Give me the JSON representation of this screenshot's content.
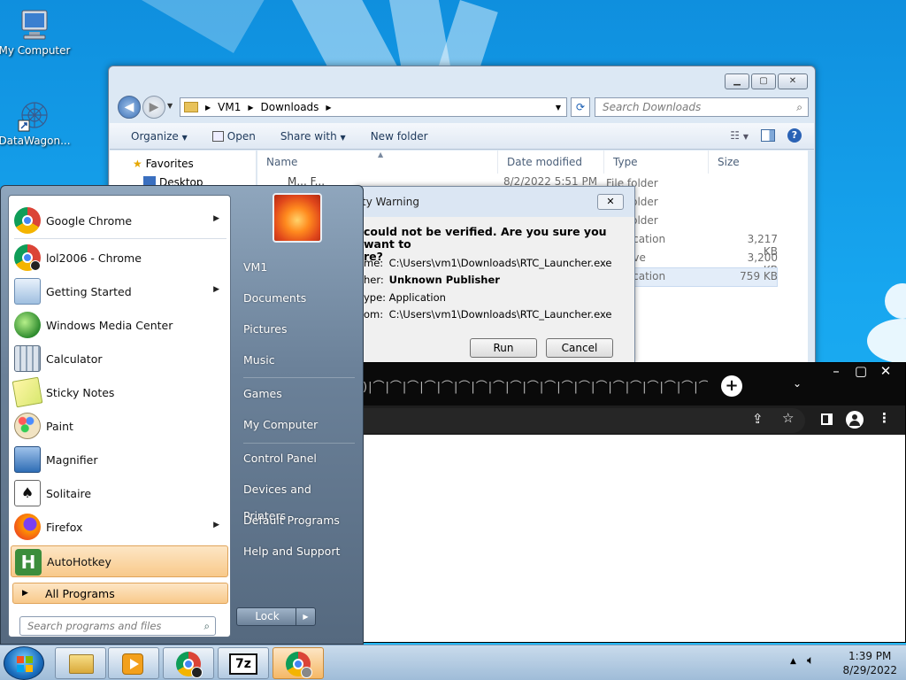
{
  "desktop": {
    "icons": [
      {
        "label": "My Computer",
        "icon": "computer-icon"
      },
      {
        "label": "DataWagon...",
        "icon": "datawagon-icon"
      }
    ]
  },
  "explorer": {
    "breadcrumb": [
      "VM1",
      "Downloads"
    ],
    "search_placeholder": "Search Downloads",
    "toolbar": {
      "organize": "Organize",
      "open": "Open",
      "share_with": "Share with",
      "new_folder": "New folder"
    },
    "nav": {
      "favorites": "Favorites",
      "desktop": "Desktop"
    },
    "columns": {
      "name": "Name",
      "date": "Date modified",
      "type": "Type",
      "size": "Size"
    },
    "row_partial": {
      "name": "M... F...",
      "date": "8/2/2022 5:51 PM",
      "type": "File folder"
    },
    "visible_types": [
      "File folder",
      "File folder",
      "File folder",
      "Application",
      "Archive",
      "Application"
    ],
    "visible_sizes": [
      "",
      "",
      "",
      "3,217 KB",
      "3,200 KB",
      "759 KB"
    ]
  },
  "security_warning": {
    "title": "ty Warning",
    "question": "could not be verified.  Are you sure you want to re?",
    "question_line1": "could not be verified.  Are you sure you want to",
    "question_line2": "re?",
    "rows": [
      {
        "label": "me:",
        "value": "C:\\Users\\vm1\\Downloads\\RTC_Launcher.exe",
        "bold": false
      },
      {
        "label": "her:",
        "value": "Unknown Publisher",
        "bold": true
      },
      {
        "label": "ype:",
        "value": "Application",
        "bold": false
      },
      {
        "label": "om:",
        "value": "C:\\Users\\vm1\\Downloads\\RTC_Launcher.exe",
        "bold": false
      }
    ],
    "run": "Run",
    "cancel": "Cancel"
  },
  "chrome_window": {
    "new_tab": "+"
  },
  "start_menu": {
    "programs": [
      {
        "label": "Google Chrome",
        "icon": "chrome-icon",
        "arrow": true
      },
      {
        "label": "lol2006 - Chrome",
        "icon": "chrome-profile-icon",
        "arrow": false
      },
      {
        "label": "Getting Started",
        "icon": "getting-started-icon",
        "arrow": true
      },
      {
        "label": "Windows Media Center",
        "icon": "media-center-icon",
        "arrow": false
      },
      {
        "label": "Calculator",
        "icon": "calculator-icon",
        "arrow": false
      },
      {
        "label": "Sticky Notes",
        "icon": "sticky-notes-icon",
        "arrow": false
      },
      {
        "label": "Paint",
        "icon": "paint-icon",
        "arrow": false
      },
      {
        "label": "Magnifier",
        "icon": "magnifier-icon",
        "arrow": false
      },
      {
        "label": "Solitaire",
        "icon": "solitaire-icon",
        "arrow": false
      },
      {
        "label": "Firefox",
        "icon": "firefox-icon",
        "arrow": true
      },
      {
        "label": "AutoHotkey",
        "icon": "autohotkey-icon",
        "arrow": false
      }
    ],
    "all_programs": "All Programs",
    "search_placeholder": "Search programs and files",
    "right_items": [
      "VM1",
      "Documents",
      "Pictures",
      "Music",
      "Games",
      "My Computer",
      "Control Panel",
      "Devices and Printers",
      "Default Programs",
      "Help and Support"
    ],
    "lock": "Lock"
  },
  "taskbar": {
    "apps": [
      "explorer-icon",
      "media-player-icon",
      "chrome-icon",
      "7zip-icon",
      "chrome-icon"
    ],
    "zip_label": "7z",
    "time": "1:39 PM",
    "date": "8/29/2022"
  }
}
